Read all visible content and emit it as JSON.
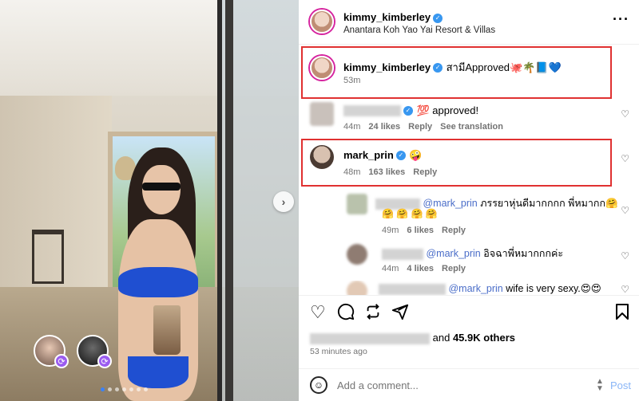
{
  "post": {
    "author": "kimmy_kimberley",
    "location": "Anantara Koh Yao Yai Resort & Villas",
    "caption": "สามีApproved🐙🌴📘💙",
    "caption_time": "53m"
  },
  "comments": [
    {
      "user": "",
      "text": "💯 approved!",
      "time": "44m",
      "likes": "24 likes",
      "reply": "Reply",
      "translate": "See translation"
    },
    {
      "user": "mark_prin",
      "text": "🤪",
      "time": "48m",
      "likes": "163 likes",
      "reply": "Reply"
    }
  ],
  "replies": [
    {
      "mention": "@mark_prin",
      "text": "ภรรยาหุ่นดีมากกกก พี่หมากก🤗",
      "emoji_line": "🤗 🤗 🤗 🤗",
      "time": "49m",
      "likes": "6 likes",
      "reply": "Reply"
    },
    {
      "mention": "@mark_prin",
      "text": "อิจฉาพี่หมากกกค่ะ",
      "time": "44m",
      "likes": "4 likes",
      "reply": "Reply"
    },
    {
      "mention": "@mark_prin",
      "text": "wife is very sexy.😍😍"
    }
  ],
  "engagement": {
    "likes_suffix_pre": "and",
    "likes_count": "45.9K others",
    "time_ago": "53 minutes ago"
  },
  "composer": {
    "placeholder": "Add a comment...",
    "post_label": "Post"
  },
  "icons": {
    "more": "more-icon",
    "like": "heart-icon",
    "comment": "comment-icon",
    "repost": "repost-icon",
    "share": "share-icon",
    "save": "bookmark-icon",
    "emoji": "smile-icon"
  },
  "colors": {
    "highlight_box": "#e03131",
    "verified": "#3897f0",
    "mention": "#4a6dc8",
    "post_button": "#8ab6f7"
  }
}
